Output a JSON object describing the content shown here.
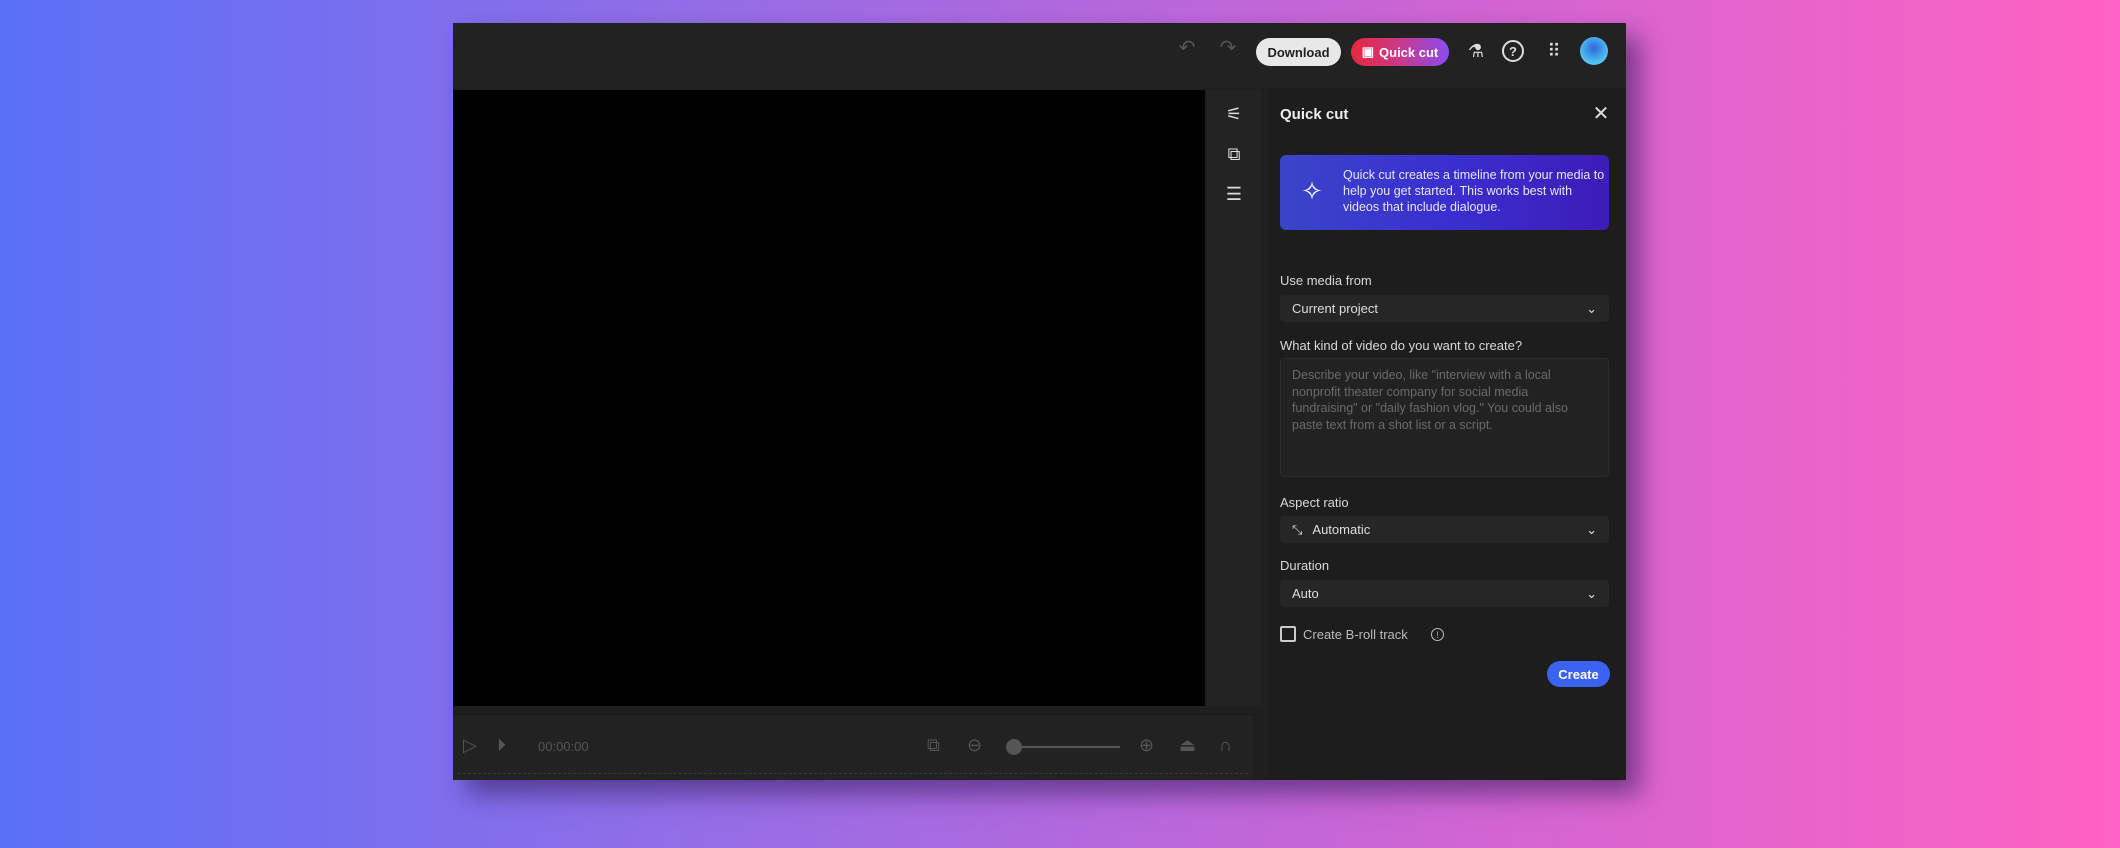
{
  "toolbar": {
    "download": "Download",
    "quick_cut": "Quick cut"
  },
  "panel": {
    "title": "Quick cut",
    "banner": "Quick cut creates a timeline from your media to help you get started. This works best with videos that include dialogue.",
    "media_label": "Use media from",
    "media_value": "Current project",
    "prompt_label": "What kind of video do you want to create?",
    "prompt_placeholder": "Describe your video, like \"interview with a local nonprofit theater company for social media fundraising\" or \"daily fashion vlog.\" You could also paste text from a shot list or a script.",
    "aspect_label": "Aspect ratio",
    "aspect_value": "Automatic",
    "duration_label": "Duration",
    "duration_value": "Auto",
    "broll_label": "Create B-roll track",
    "create": "Create"
  },
  "playback": {
    "timecode": "00:00:00"
  },
  "colors": {
    "accent": "#3b63f3",
    "quick_cut_start": "#e8273c",
    "quick_cut_end": "#8a4cf0"
  }
}
